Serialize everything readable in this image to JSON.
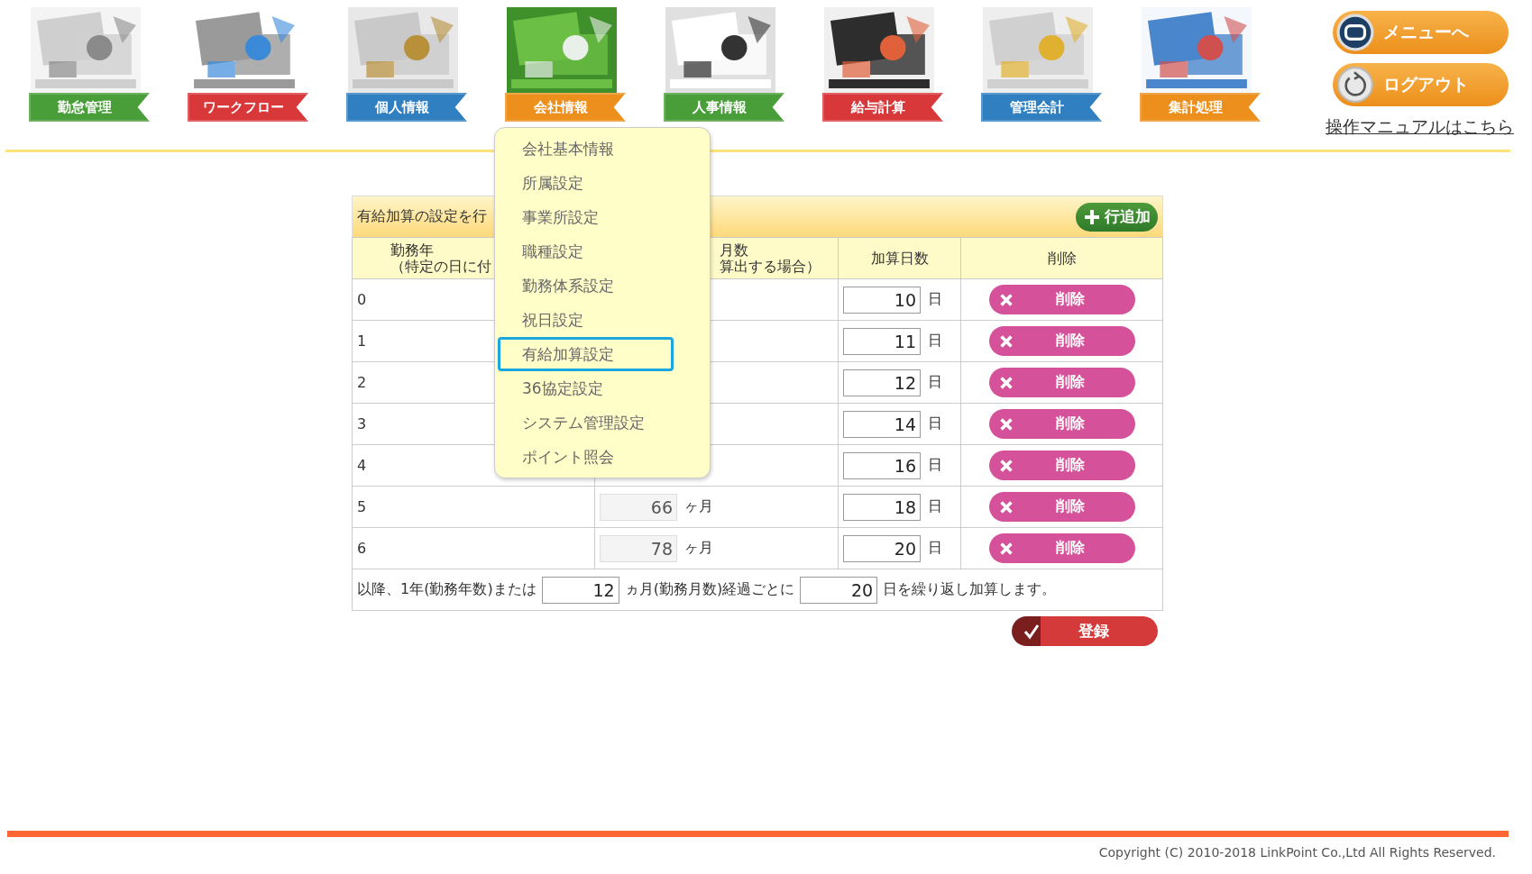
{
  "nav": [
    {
      "label": "勤怠管理",
      "color": "#4a9e3a"
    },
    {
      "label": "ワークフロー",
      "color": "#d9383a"
    },
    {
      "label": "個人情報",
      "color": "#2f7fc1"
    },
    {
      "label": "会社情報",
      "color": "#ec8f1c"
    },
    {
      "label": "人事情報",
      "color": "#4a9e3a"
    },
    {
      "label": "給与計算",
      "color": "#d9383a"
    },
    {
      "label": "管理会計",
      "color": "#2f7fc1"
    },
    {
      "label": "集計処理",
      "color": "#ec8f1c"
    }
  ],
  "top_buttons": [
    {
      "kind": "menu",
      "label": "メニューへ"
    },
    {
      "kind": "logout",
      "label": "ログアウト"
    }
  ],
  "manual_link": "操作マニュアルはこちら",
  "panel": {
    "title": "有給加算の設定を行",
    "add_button": "行追加",
    "columns": [
      {
        "lines": [
          "勤務年",
          "（特定の日に付"
        ]
      },
      {
        "lines": [
          "月数",
          "算出する場合）"
        ]
      },
      {
        "lines": [
          "加算日数"
        ]
      },
      {
        "lines": [
          "削除"
        ]
      }
    ],
    "rows": [
      {
        "years": "0",
        "days": "10",
        "days_unit": "日",
        "delete": "削除"
      },
      {
        "years": "1",
        "days": "11",
        "days_unit": "日",
        "delete": "削除"
      },
      {
        "years": "2",
        "days": "12",
        "days_unit": "日",
        "delete": "削除"
      },
      {
        "years": "3",
        "days": "14",
        "days_unit": "日",
        "delete": "削除"
      },
      {
        "years": "4",
        "days": "16",
        "days_unit": "日",
        "delete": "削除"
      },
      {
        "years": "5",
        "months": "66",
        "months_unit": "ヶ月",
        "days": "18",
        "days_unit": "日",
        "delete": "削除"
      },
      {
        "years": "6",
        "months": "78",
        "months_unit": "ヶ月",
        "days": "20",
        "days_unit": "日",
        "delete": "削除"
      }
    ],
    "repeat": {
      "text_1": "以降、1年(勤務年数)または",
      "months": "12",
      "text_2": "ヵ月(勤務月数)経過ごとに",
      "days": "20",
      "text_3": "日を繰り返し加算します。"
    },
    "register_button": "登録"
  },
  "dropdown": {
    "items": [
      {
        "label": "会社基本情報",
        "selected": false
      },
      {
        "label": "所属設定",
        "selected": false
      },
      {
        "label": "事業所設定",
        "selected": false
      },
      {
        "label": "職種設定",
        "selected": false
      },
      {
        "label": "勤務体系設定",
        "selected": false
      },
      {
        "label": "祝日設定",
        "selected": false
      },
      {
        "label": "有給加算設定",
        "selected": true
      },
      {
        "label": "36協定設定",
        "selected": false
      },
      {
        "label": "システム管理設定",
        "selected": false
      },
      {
        "label": "ポイント照会",
        "selected": false
      }
    ]
  },
  "footer": {
    "copyright": "Copyright (C) 2010-2018 LinkPoint Co.,Ltd All Rights Reserved."
  }
}
